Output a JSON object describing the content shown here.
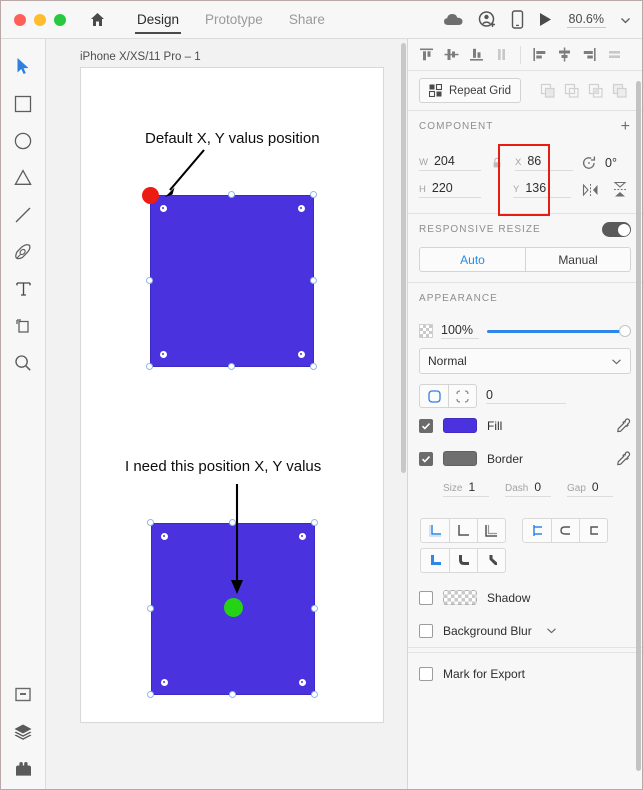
{
  "titlebar": {
    "window_controls": [
      "close",
      "minimize",
      "maximize"
    ],
    "home_icon": "home-icon",
    "tabs": [
      {
        "label": "Design",
        "active": true
      },
      {
        "label": "Prototype",
        "active": false
      },
      {
        "label": "Share",
        "active": false
      }
    ],
    "cloud_icon": "cloud-icon",
    "invite_icon": "invite-user-icon",
    "device_preview_icon": "mobile-device-icon",
    "play_icon": "play-icon",
    "zoom_level": "80.6%",
    "zoom_chevron": "chevron-down-icon"
  },
  "toolbar": {
    "tools": [
      {
        "name": "select-tool",
        "icon": "cursor-arrow-icon",
        "active": true
      },
      {
        "name": "rectangle-tool",
        "icon": "square-icon",
        "active": false
      },
      {
        "name": "ellipse-tool",
        "icon": "circle-icon",
        "active": false
      },
      {
        "name": "polygon-tool",
        "icon": "triangle-icon",
        "active": false
      },
      {
        "name": "line-tool",
        "icon": "line-icon",
        "active": false
      },
      {
        "name": "pen-tool",
        "icon": "pen-icon",
        "active": false
      },
      {
        "name": "text-tool",
        "icon": "text-t-icon",
        "active": false
      },
      {
        "name": "artboard-tool",
        "icon": "artboard-icon",
        "active": false
      },
      {
        "name": "zoom-tool",
        "icon": "magnifier-icon",
        "active": false
      }
    ],
    "bottom_tools": [
      {
        "name": "assets-panel",
        "icon": "library-icon",
        "active": false
      },
      {
        "name": "layers-panel",
        "icon": "layers-icon",
        "active": true
      },
      {
        "name": "plugins-panel",
        "icon": "plugins-icon",
        "active": false
      }
    ]
  },
  "canvas": {
    "artboard_label": "iPhone X/XS/11 Pro – 1",
    "annotation_top": "Default X, Y  valus position",
    "annotation_bottom": "I need this position X, Y  valus",
    "shape_fill_color": "#4a33de",
    "marker_top_color": "#ec1c13",
    "marker_bottom_color": "#25d215",
    "arrow_color": "#000000"
  },
  "inspector": {
    "align_vertical": [
      {
        "name": "align-top-icon"
      },
      {
        "name": "align-middle-icon"
      },
      {
        "name": "align-bottom-icon"
      },
      {
        "name": "distribute-vertical-icon"
      }
    ],
    "align_horizontal": [
      {
        "name": "align-left-icon"
      },
      {
        "name": "align-center-icon"
      },
      {
        "name": "align-right-icon"
      },
      {
        "name": "distribute-horizontal-icon"
      }
    ],
    "repeat_grid_label": "Repeat Grid",
    "repeat_grid_icon": "grid-icon",
    "boolean_ops": [
      {
        "name": "boolean-add-icon"
      },
      {
        "name": "boolean-subtract-icon"
      },
      {
        "name": "boolean-intersect-icon"
      },
      {
        "name": "boolean-exclude-icon"
      }
    ],
    "component": {
      "title": "COMPONENT",
      "add_label": "+"
    },
    "geometry": {
      "w_label": "W",
      "w_value": "204",
      "h_label": "H",
      "h_value": "220",
      "x_label": "X",
      "x_value": "86",
      "y_label": "Y",
      "y_value": "136",
      "lock_icon": "link-lock-icon",
      "rotation_icon": "rotate-icon",
      "rotation_value": "0°",
      "flip_horizontal_icon": "flip-horizontal-icon",
      "flip_vertical_icon": "flip-vertical-icon",
      "highlight_color": "#e61d13"
    },
    "responsive_resize": {
      "title": "RESPONSIVE RESIZE",
      "enabled": true,
      "modes": [
        {
          "label": "Auto",
          "active": true
        },
        {
          "label": "Manual",
          "active": false
        }
      ]
    },
    "appearance": {
      "title": "APPEARANCE",
      "opacity_icon": "checkerboard-icon",
      "opacity_value": "100%",
      "blend_mode": "Normal",
      "blend_chevron": "chevron-down-icon",
      "corner_all_icon": "corner-radius-all-icon",
      "corner_individual_icon": "corner-radius-individual-icon",
      "corner_radius_value": "0",
      "fill": {
        "label": "Fill",
        "checked": true,
        "color": "#4a33de",
        "eyedropper_icon": "eyedropper-icon"
      },
      "border": {
        "label": "Border",
        "checked": true,
        "color": "#6f6f6f",
        "eyedropper_icon": "eyedropper-icon",
        "size_label": "Size",
        "size_value": "1",
        "dash_label": "Dash",
        "dash_value": "0",
        "gap_label": "Gap",
        "gap_value": "0"
      },
      "border_align_icons": [
        {
          "name": "border-align-inside-icon",
          "active": true
        },
        {
          "name": "border-align-center-icon",
          "active": false
        },
        {
          "name": "border-align-outside-icon",
          "active": false
        }
      ],
      "cap_icons": [
        {
          "name": "cap-butt-icon",
          "active": true
        },
        {
          "name": "cap-round-icon",
          "active": false
        },
        {
          "name": "cap-square-icon",
          "active": false
        }
      ],
      "join_icons": [
        {
          "name": "join-miter-icon",
          "active": true
        },
        {
          "name": "join-round-icon",
          "active": false
        },
        {
          "name": "join-bevel-icon",
          "active": false
        }
      ],
      "shadow": {
        "label": "Shadow",
        "checked": false
      },
      "background_blur": {
        "label": "Background Blur",
        "checked": false,
        "chevron": "chevron-down-icon"
      }
    },
    "export": {
      "mark_for_export_label": "Mark for Export",
      "checked": false
    }
  }
}
